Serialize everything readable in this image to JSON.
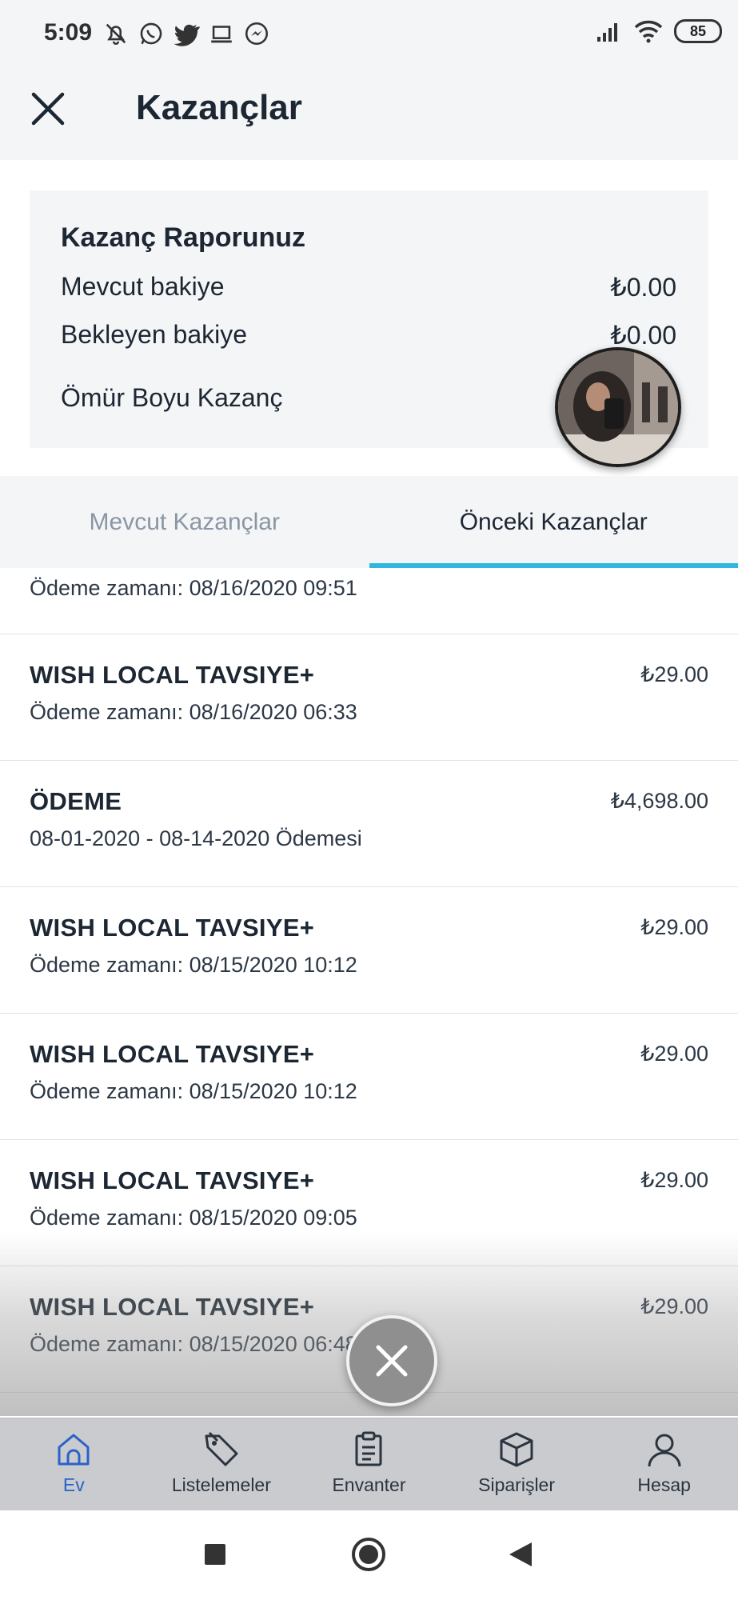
{
  "status_bar": {
    "time": "5:09",
    "battery": "85"
  },
  "header": {
    "title": "Kazançlar"
  },
  "report": {
    "title": "Kazanç Raporunuz",
    "rows": [
      {
        "label": "Mevcut bakiye",
        "value": "₺0.00"
      },
      {
        "label": "Bekleyen bakiye",
        "value": "₺0.00"
      },
      {
        "label": "Ömür Boyu Kazanç",
        "value": "₺"
      }
    ]
  },
  "tabs": [
    {
      "label": "Mevcut Kazançlar",
      "active": false
    },
    {
      "label": "Önceki Kazançlar",
      "active": true
    }
  ],
  "earnings": {
    "partial_item": {
      "subtitle": "Ödeme zamanı: 08/16/2020 09:51"
    },
    "items": [
      {
        "title": "WISH LOCAL TAVSIYE+",
        "subtitle": "Ödeme zamanı: 08/16/2020 06:33",
        "amount": "₺29.00"
      },
      {
        "title": "ÖDEME",
        "subtitle": "08-01-2020 - 08-14-2020 Ödemesi",
        "amount": "₺4,698.00"
      },
      {
        "title": "WISH LOCAL TAVSIYE+",
        "subtitle": "Ödeme zamanı: 08/15/2020 10:12",
        "amount": "₺29.00"
      },
      {
        "title": "WISH LOCAL TAVSIYE+",
        "subtitle": "Ödeme zamanı: 08/15/2020 10:12",
        "amount": "₺29.00"
      },
      {
        "title": "WISH LOCAL TAVSIYE+",
        "subtitle": "Ödeme zamanı: 08/15/2020 09:05",
        "amount": "₺29.00"
      },
      {
        "title": "WISH LOCAL TAVSIYE+",
        "subtitle": "Ödeme zamanı: 08/15/2020 06:48",
        "amount": "₺29.00"
      }
    ]
  },
  "bottom_nav": [
    {
      "label": "Ev",
      "icon": "home-icon",
      "active": true
    },
    {
      "label": "Listelemeler",
      "icon": "tag-icon",
      "active": false
    },
    {
      "label": "Envanter",
      "icon": "clipboard-icon",
      "active": false
    },
    {
      "label": "Siparişler",
      "icon": "box-icon",
      "active": false
    },
    {
      "label": "Hesap",
      "icon": "person-icon",
      "active": false
    }
  ],
  "colors": {
    "accent": "#2fb7e0",
    "nav_active": "#2a62c9"
  }
}
